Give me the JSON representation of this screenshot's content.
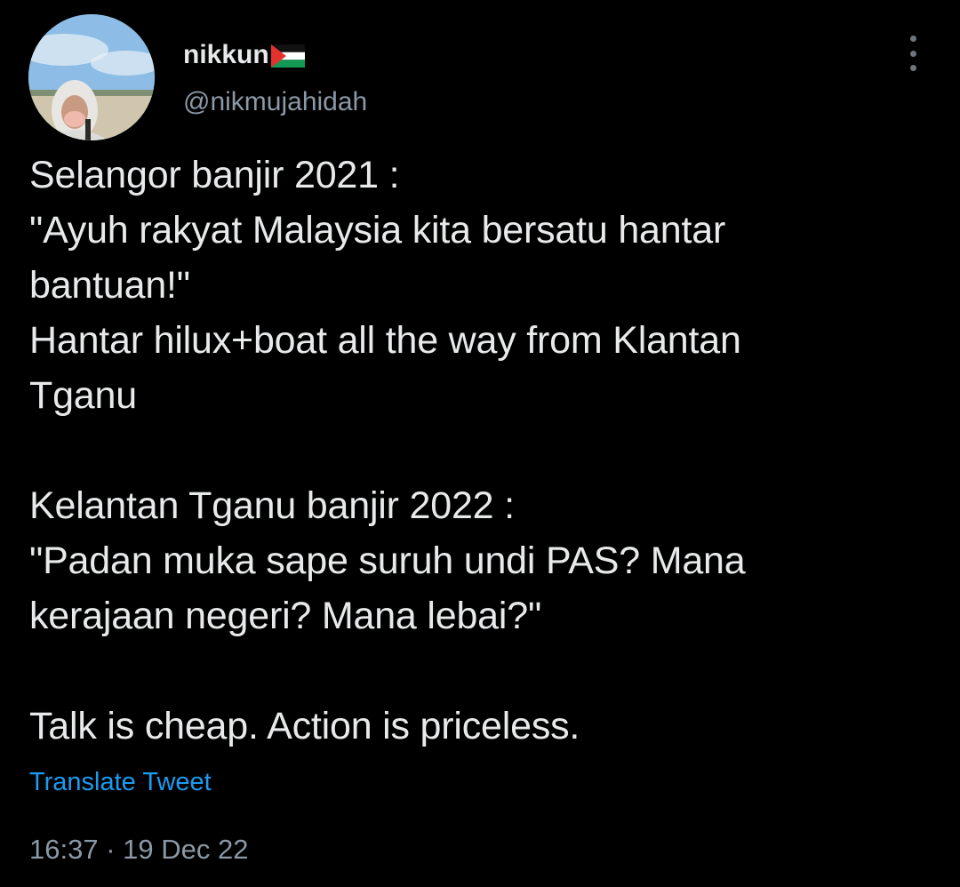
{
  "author": {
    "display_name": "nikkun",
    "flag_icon": "palestine-flag-icon",
    "handle": "@nikmujahidah"
  },
  "tweet": {
    "lines": [
      "Selangor banjir 2021 :",
      "\"Ayuh rakyat Malaysia kita bersatu hantar",
      "bantuan!\"",
      "Hantar hilux+boat all the way from Klantan",
      "Tganu",
      "",
      "Kelantan Tganu banjir 2022 :",
      "\"Padan muka sape suruh undi PAS? Mana",
      "kerajaan negeri? Mana lebai?\"",
      "",
      "Talk is cheap. Action is priceless."
    ],
    "translate_label": "Translate Tweet",
    "time": "16:37",
    "separator": "·",
    "date": "19 Dec 22"
  },
  "colors": {
    "background": "#000000",
    "text": "#e7e9ea",
    "secondary": "#8b98a5",
    "link": "#1d9bf0"
  }
}
